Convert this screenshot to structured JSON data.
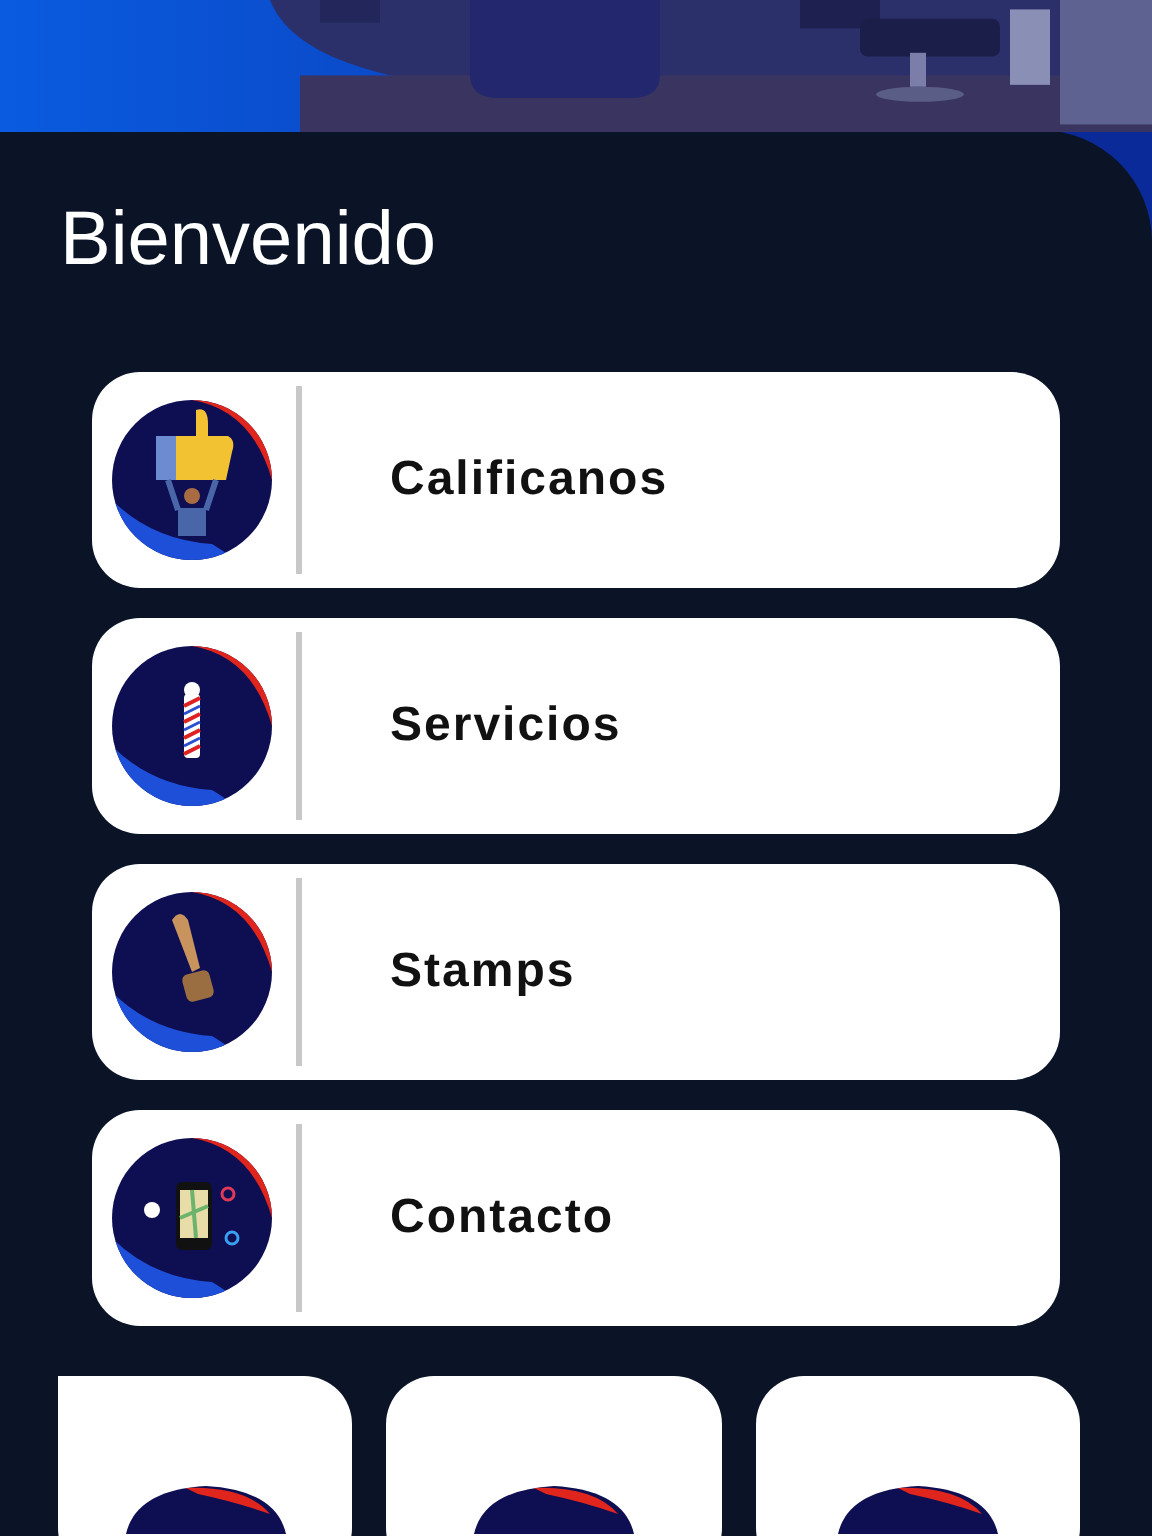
{
  "title": "Bienvenido",
  "menu": [
    {
      "label": "Calificanos",
      "kind": "thumbs"
    },
    {
      "label": "Servicios",
      "kind": "pole"
    },
    {
      "label": "Stamps",
      "kind": "stamp"
    },
    {
      "label": "Contacto",
      "kind": "map"
    }
  ]
}
